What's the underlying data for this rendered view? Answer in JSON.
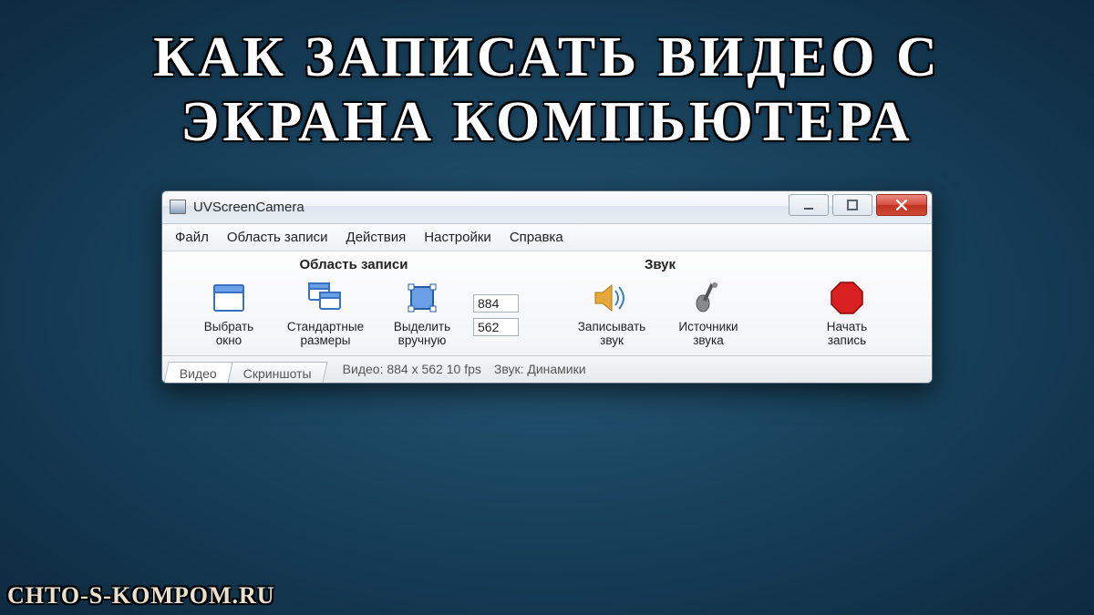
{
  "headline": "КАК ЗАПИСАТЬ ВИДЕО С\nЭКРАНА КОМПЬЮТЕРА",
  "site": "CHTO-S-KOMPOM.RU",
  "window": {
    "title": "UVScreenCamera",
    "menu": [
      "Файл",
      "Область записи",
      "Действия",
      "Настройки",
      "Справка"
    ],
    "groups": {
      "area": {
        "heading": "Область записи",
        "select_window": "Выбрать\nокно",
        "standard_sizes": "Стандартные\nразмеры",
        "select_manual": "Выделить\nвручную",
        "width": "884",
        "height": "562"
      },
      "sound": {
        "heading": "Звук",
        "record_sound": "Записывать\nзвук",
        "sound_sources": "Источники\nзвука"
      },
      "record": {
        "start": "Начать\nзапись"
      }
    },
    "tabs": {
      "video": "Видео",
      "screenshots": "Скриншоты"
    },
    "status": {
      "video": "Видео: 884 x 562  10 fps",
      "sound": "Звук: Динамики"
    }
  }
}
